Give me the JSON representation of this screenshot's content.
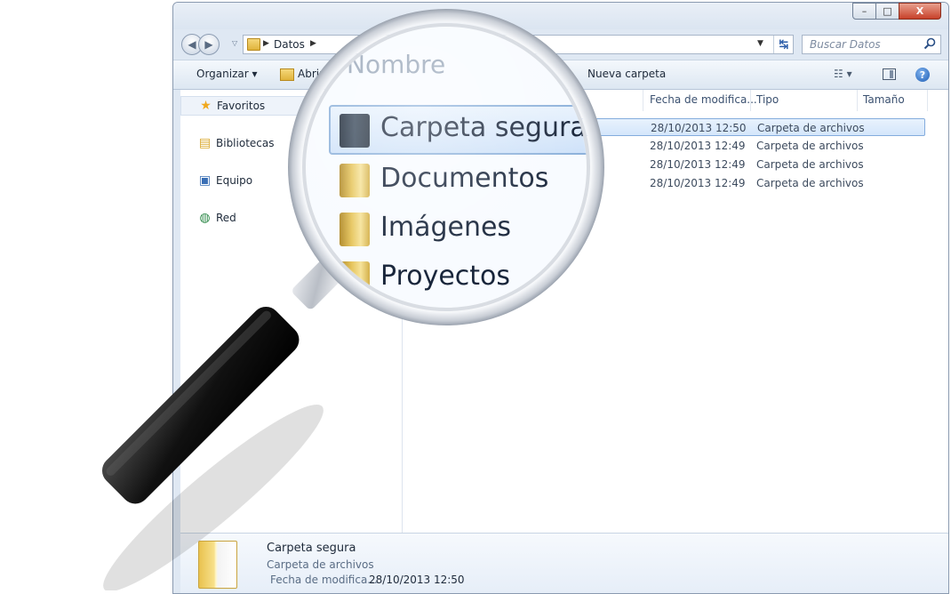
{
  "window": {
    "minimize": "–",
    "maximize": "□",
    "close": "X"
  },
  "address": {
    "crumb": "Datos",
    "search_placeholder": "Buscar Datos"
  },
  "toolbar": {
    "organize": "Organizar",
    "open": "Abrir",
    "new_folder": "Nueva carpeta"
  },
  "nav": {
    "items": [
      {
        "label": "Favoritos",
        "icon": "star-icon"
      },
      {
        "label": "Bibliotecas",
        "icon": "libraries-icon"
      },
      {
        "label": "Equipo",
        "icon": "computer-icon"
      },
      {
        "label": "Red",
        "icon": "network-icon"
      }
    ]
  },
  "list": {
    "columns": {
      "name": "Nombre",
      "date": "Fecha de modifica...",
      "type": "Tipo",
      "size": "Tamaño"
    },
    "rows": [
      {
        "name": "Carpeta segura",
        "date": "28/10/2013 12:50",
        "type": "Carpeta de archivos",
        "selected": true
      },
      {
        "name": "Documentos",
        "date": "28/10/2013 12:49",
        "type": "Carpeta de archivos",
        "selected": false
      },
      {
        "name": "Imágenes",
        "date": "28/10/2013 12:49",
        "type": "Carpeta de archivos",
        "selected": false
      },
      {
        "name": "Proyectos",
        "date": "28/10/2013 12:49",
        "type": "Carpeta de archivos",
        "selected": false
      }
    ]
  },
  "details": {
    "name": "Carpeta segura",
    "type": "Carpeta de archivos",
    "modified_label": "Fecha de modifica...",
    "modified_value": "28/10/2013 12:50"
  },
  "colors": {
    "selection": "#cfe2f9",
    "accent": "#1f5eb5"
  }
}
